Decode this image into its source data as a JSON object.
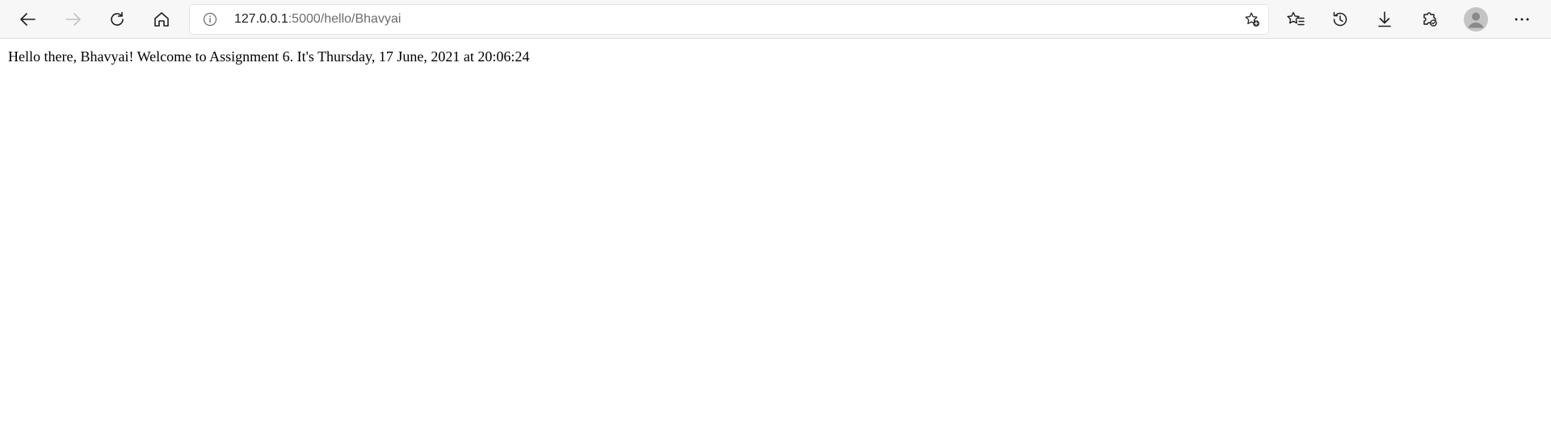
{
  "browser": {
    "address": {
      "host": "127.0.0.1",
      "path": ":5000/hello/Bhavyai"
    },
    "icons": {
      "back": "back-arrow-icon",
      "forward": "forward-arrow-icon",
      "refresh": "refresh-icon",
      "home": "home-icon",
      "site_info": "info-icon",
      "add_favorite": "add-favorite-icon",
      "favorites": "favorites-icon",
      "history": "history-icon",
      "downloads": "download-icon",
      "extensions": "extensions-icon",
      "profile": "profile-avatar-icon",
      "menu": "more-menu-icon"
    }
  },
  "page": {
    "message": "Hello there, Bhavyai! Welcome to Assignment 6. It's Thursday, 17 June, 2021 at 20:06:24"
  }
}
